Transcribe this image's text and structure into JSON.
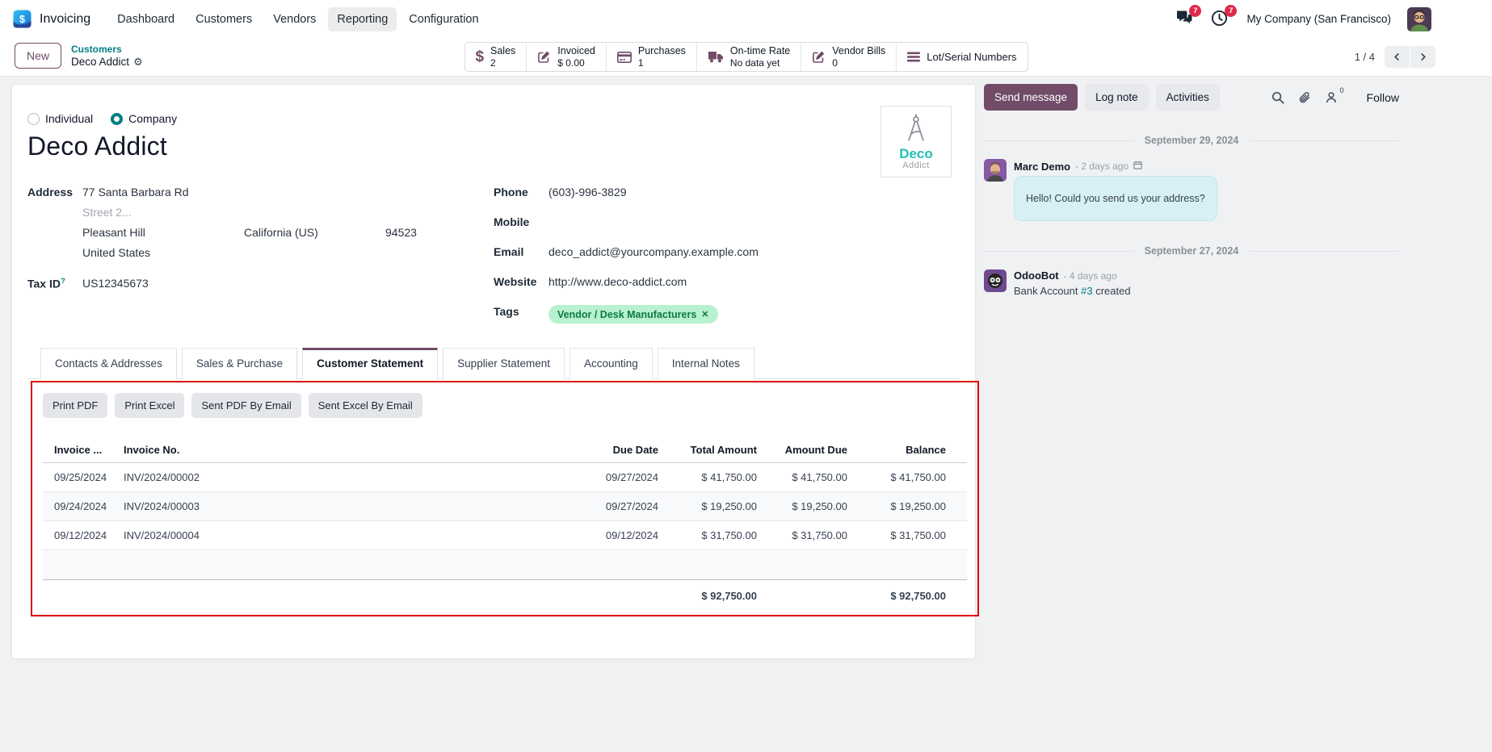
{
  "colors": {
    "primary_purple": "#714B67",
    "accent_teal": "#017E84",
    "badge_red": "#E0284A",
    "tag_green_bg": "#B7F1CF",
    "tag_green_text": "#0C7A43",
    "bubble_blue": "#D7F0F4",
    "highlight_red": "#E10600",
    "logo_teal": "#22C0B4"
  },
  "topbar": {
    "app_name": "Invoicing",
    "menu_items": [
      "Dashboard",
      "Customers",
      "Vendors",
      "Reporting",
      "Configuration"
    ],
    "active_menu": "Reporting",
    "messages_badge": "7",
    "activities_badge": "7",
    "company": "My Company (San Francisco)"
  },
  "control_panel": {
    "new_label": "New",
    "breadcrumb_parent": "Customers",
    "breadcrumb_current": "Deco Addict",
    "pager_text": "1 / 4"
  },
  "stat_buttons": [
    {
      "icon": "dollar-icon",
      "label": "Sales",
      "value": "2"
    },
    {
      "icon": "edit-note-icon",
      "label": "Invoiced",
      "value": "$ 0.00"
    },
    {
      "icon": "credit-card-icon",
      "label": "Purchases",
      "value": "1"
    },
    {
      "icon": "truck-icon",
      "label": "On-time Rate",
      "value": "No data yet"
    },
    {
      "icon": "edit-note-icon",
      "label": "Vendor Bills",
      "value": "0"
    },
    {
      "icon": "menu-bars-icon",
      "label": "Lot/Serial Numbers",
      "value": ""
    }
  ],
  "form": {
    "type_options": [
      {
        "label": "Individual",
        "checked": false
      },
      {
        "label": "Company",
        "checked": true
      }
    ],
    "company_name": "Deco Addict",
    "logo": {
      "line1": "Deco",
      "line2": "Addict"
    },
    "fields": {
      "address_label": "Address",
      "street": "77 Santa Barbara Rd",
      "street2_placeholder": "Street 2...",
      "city": "Pleasant Hill",
      "state": "California (US)",
      "zip": "94523",
      "country": "United States",
      "tax_id_label": "Tax ID",
      "tax_id_help": "?",
      "tax_id_value": "US12345673",
      "phone_label": "Phone",
      "phone_value": "(603)-996-3829",
      "mobile_label": "Mobile",
      "mobile_value": "",
      "email_label": "Email",
      "email_value": "deco_addict@yourcompany.example.com",
      "website_label": "Website",
      "website_value": "http://www.deco-addict.com",
      "tags_label": "Tags",
      "tags": [
        {
          "name": "Vendor / Desk Manufacturers"
        }
      ]
    },
    "tabs": [
      {
        "label": "Contacts & Addresses",
        "active": false
      },
      {
        "label": "Sales & Purchase",
        "active": false
      },
      {
        "label": "Customer Statement",
        "active": true
      },
      {
        "label": "Supplier Statement",
        "active": false
      },
      {
        "label": "Accounting",
        "active": false
      },
      {
        "label": "Internal Notes",
        "active": false
      }
    ]
  },
  "statement": {
    "actions": [
      "Print PDF",
      "Print Excel",
      "Sent PDF By Email",
      "Sent Excel By Email"
    ],
    "columns": [
      "Invoice ...",
      "Invoice No.",
      "Due Date",
      "Total Amount",
      "Amount Due",
      "Balance"
    ],
    "rows": [
      [
        "09/25/2024",
        "INV/2024/00002",
        "09/27/2024",
        "$ 41,750.00",
        "$ 41,750.00",
        "$ 41,750.00"
      ],
      [
        "09/24/2024",
        "INV/2024/00003",
        "09/27/2024",
        "$ 19,250.00",
        "$ 19,250.00",
        "$ 19,250.00"
      ],
      [
        "09/12/2024",
        "INV/2024/00004",
        "09/12/2024",
        "$ 31,750.00",
        "$ 31,750.00",
        "$ 31,750.00"
      ]
    ],
    "totals": {
      "total_amount": "$ 92,750.00",
      "balance": "$ 92,750.00"
    }
  },
  "chatter": {
    "send_message_label": "Send message",
    "log_note_label": "Log note",
    "activities_label": "Activities",
    "followers_count": "0",
    "follow_label": "Follow",
    "day1": {
      "date": "September 29, 2024",
      "author": "Marc Demo",
      "time_ago": "- 2 days ago",
      "message": "Hello! Could you send us your address?"
    },
    "day2": {
      "date": "September 27, 2024",
      "author": "OdooBot",
      "time_ago": "- 4 days ago",
      "note_prefix": "Bank Account ",
      "note_link": "#3",
      "note_suffix": " created"
    }
  }
}
